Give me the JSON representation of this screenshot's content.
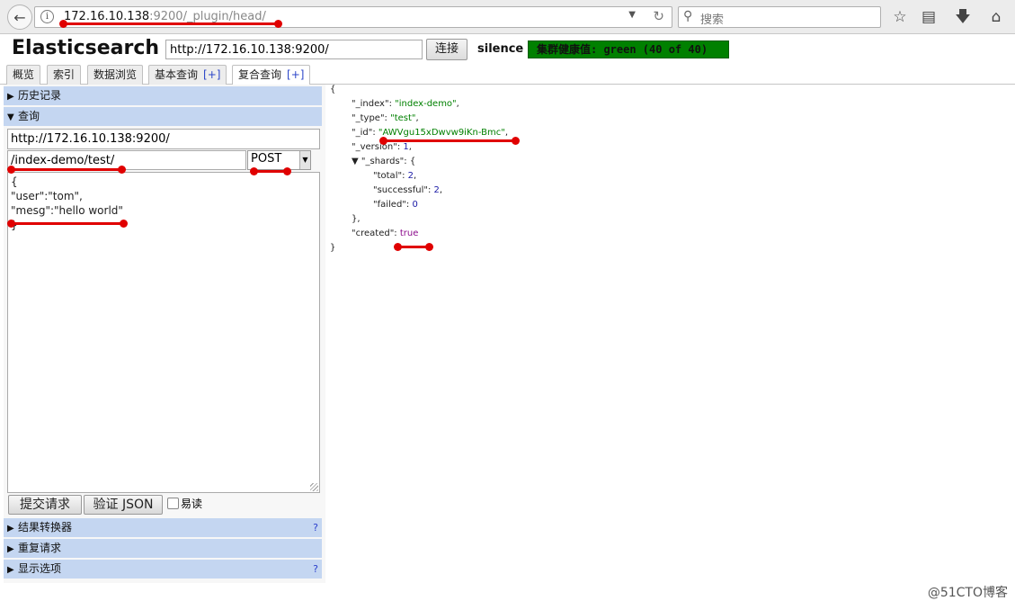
{
  "browser": {
    "url_host": "172.16.10.138",
    "url_path": ":9200/_plugin/head/",
    "search_placeholder": "搜索"
  },
  "app": {
    "title": "Elasticsearch",
    "cluster_url": "http://172.16.10.138:9200/",
    "connect_label": "连接",
    "cluster_name": "silence",
    "health_text": "集群健康值: green (40 of 40)",
    "health_color": "#008000"
  },
  "tabs": [
    {
      "label": "概览"
    },
    {
      "label": "索引"
    },
    {
      "label": "数据浏览"
    },
    {
      "label": "基本查询",
      "plus": "[+]"
    },
    {
      "label": "复合查询",
      "plus": "[+]"
    }
  ],
  "left": {
    "history_label": "历史记录",
    "query_label": "查询",
    "server_url": "http://172.16.10.138:9200/",
    "path": "/index-demo/test/",
    "method": "POST",
    "body": "{\n\"user\":\"tom\",\n\"mesg\":\"hello world\"\n}",
    "submit_label": "提交请求",
    "validate_label": "验证 JSON",
    "easy_read_label": "易读",
    "result_transformer_label": "结果转换器",
    "repeat_label": "重复请求",
    "display_options_label": "显示选项",
    "help": "?"
  },
  "response": {
    "open_brace": "{",
    "index_key": "\"_index\"",
    "index_val": "\"index-demo\"",
    "type_key": "\"_type\"",
    "type_val": "\"test\"",
    "id_key": "\"_id\"",
    "id_val": "\"AWVgu15xDwvw9iKn-Bmc\"",
    "version_key": "\"_version\"",
    "version_val": "1",
    "shards_key": "\"_shards\"",
    "total_key": "\"total\"",
    "total_val": "2",
    "successful_key": "\"successful\"",
    "successful_val": "2",
    "failed_key": "\"failed\"",
    "failed_val": "0",
    "created_key": "\"created\"",
    "created_val": "true",
    "close_brace": "}"
  },
  "watermark": "@51CTO博客"
}
